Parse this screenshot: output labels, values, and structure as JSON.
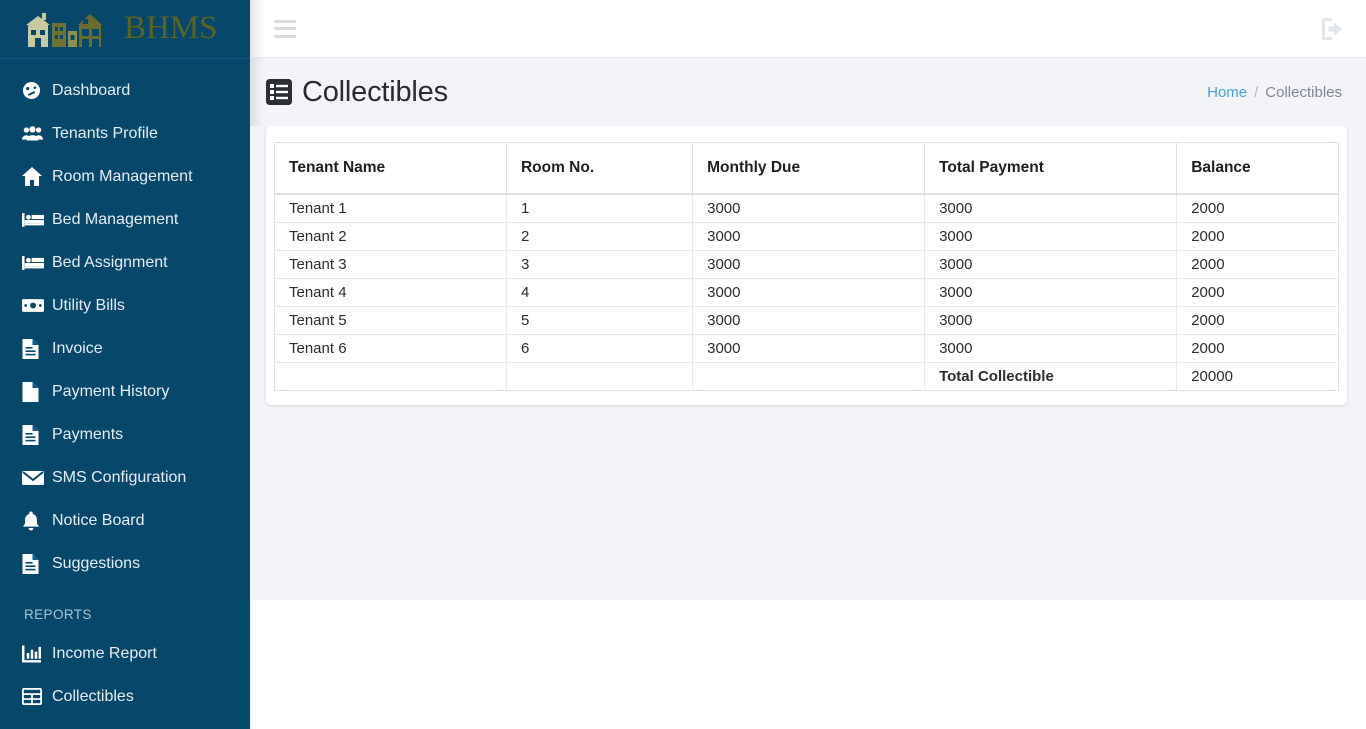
{
  "brand": {
    "name": "BHMS",
    "logo_icon": "buildings-logo-icon"
  },
  "sidebar": {
    "items": [
      {
        "label": "Dashboard",
        "icon": "dashboard-gauge-icon"
      },
      {
        "label": "Tenants Profile",
        "icon": "users-group-icon"
      },
      {
        "label": "Room Management",
        "icon": "home-icon"
      },
      {
        "label": "Bed Management",
        "icon": "bed-icon"
      },
      {
        "label": "Bed Assignment",
        "icon": "bed-icon"
      },
      {
        "label": "Utility Bills",
        "icon": "money-bill-icon"
      },
      {
        "label": "Invoice",
        "icon": "file-invoice-icon"
      },
      {
        "label": "Payment History",
        "icon": "file-icon"
      },
      {
        "label": "Payments",
        "icon": "file-invoice-icon"
      },
      {
        "label": "SMS Configuration",
        "icon": "envelope-icon"
      },
      {
        "label": "Notice Board",
        "icon": "bell-icon"
      },
      {
        "label": "Suggestions",
        "icon": "file-invoice-icon"
      }
    ],
    "section_reports": "Reports",
    "report_items": [
      {
        "label": "Income Report",
        "icon": "bar-chart-icon"
      },
      {
        "label": "Collectibles",
        "icon": "table-grid-icon"
      }
    ]
  },
  "navbar": {
    "menu_toggle_icon": "hamburger-menu-icon",
    "logout_icon": "sign-out-icon"
  },
  "page": {
    "title": "Collectibles",
    "title_icon": "list-table-icon",
    "breadcrumb": {
      "home": "Home",
      "separator": "/",
      "current": "Collectibles"
    }
  },
  "table": {
    "columns": [
      "Tenant Name",
      "Room No.",
      "Monthly Due",
      "Total Payment",
      "Balance"
    ],
    "rows": [
      [
        "Tenant 1",
        "1",
        "3000",
        "3000",
        "2000"
      ],
      [
        "Tenant 2",
        "2",
        "3000",
        "3000",
        "2000"
      ],
      [
        "Tenant 3",
        "3",
        "3000",
        "3000",
        "2000"
      ],
      [
        "Tenant 4",
        "4",
        "3000",
        "3000",
        "2000"
      ],
      [
        "Tenant 5",
        "5",
        "3000",
        "3000",
        "2000"
      ],
      [
        "Tenant 6",
        "6",
        "3000",
        "3000",
        "2000"
      ]
    ],
    "total_row": {
      "c0": "",
      "c1": "",
      "c2": "",
      "label": "Total Collectible",
      "value": "20000"
    }
  },
  "colors": {
    "sidebar_bg": "#07486a",
    "brand_text": "#5b6324",
    "content_bg": "#f3f4f8",
    "link_blue": "#4a9fe0"
  }
}
